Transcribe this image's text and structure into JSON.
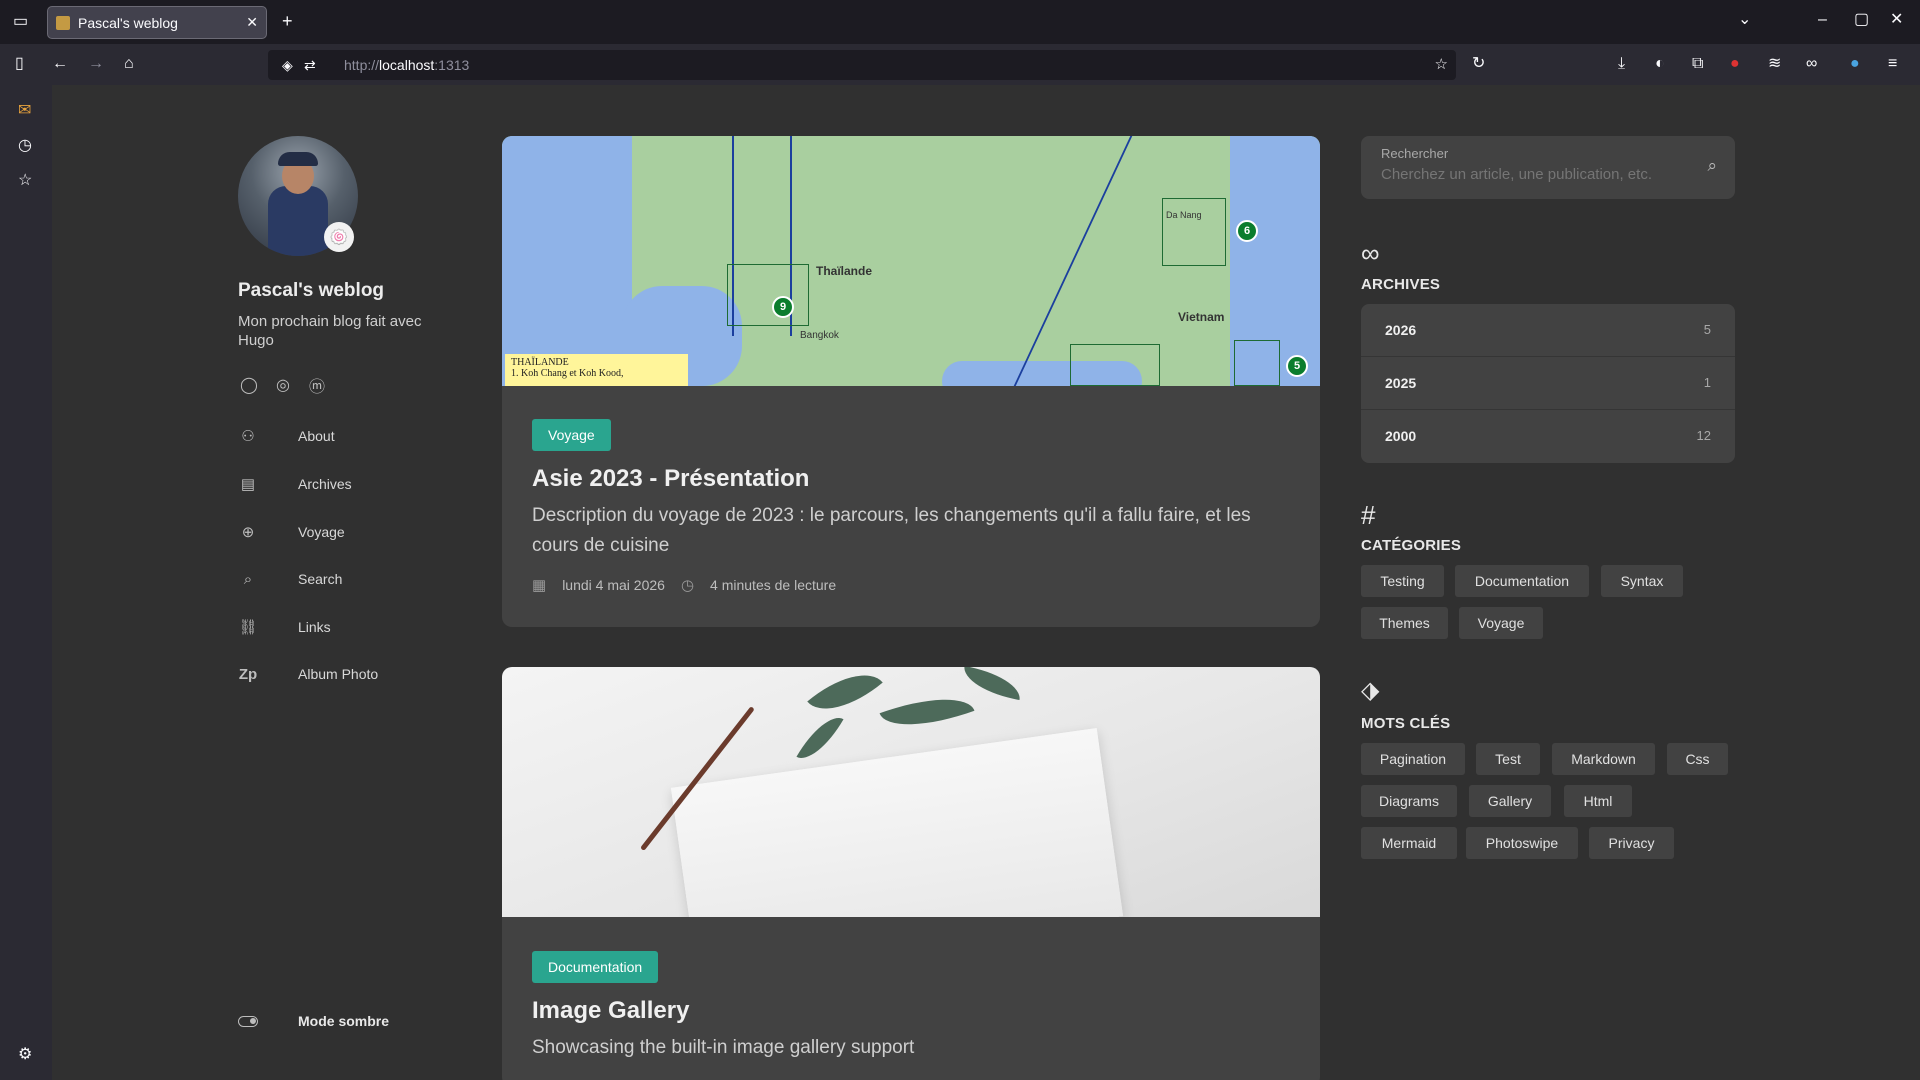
{
  "browser": {
    "tab_title": "Pascal's weblog",
    "url_prefix": "http://",
    "url_host": "localhost",
    "url_port": ":1313"
  },
  "profile": {
    "name": "Pascal's weblog",
    "description": "Mon prochain blog fait avec Hugo",
    "badge_emoji": "🍥"
  },
  "menu": {
    "items": [
      {
        "label": "About",
        "icon": "user-icon"
      },
      {
        "label": "Archives",
        "icon": "archive-icon"
      },
      {
        "label": "Voyage",
        "icon": "globe-icon"
      },
      {
        "label": "Search",
        "icon": "search-icon"
      },
      {
        "label": "Links",
        "icon": "link-icon"
      },
      {
        "label": "Album Photo",
        "icon": "zp-icon"
      }
    ],
    "dark_mode_label": "Mode sombre"
  },
  "articles": [
    {
      "category": "Voyage",
      "title": "Asie 2023 - Présentation",
      "description": "Description du voyage de 2023 : le parcours, les changements qu'il a fallu faire, et les cours de cuisine",
      "date": "lundi 4 mai 2026",
      "reading_time": "4 minutes de lecture",
      "map": {
        "labels": [
          "Thaïlande",
          "Vietnam",
          "Bangkok",
          "Da Nang"
        ],
        "pins": [
          "9",
          "6",
          "5"
        ],
        "legend_line1": "THAÏLANDE",
        "legend_line2": "1. Koh Chang et Koh Kood,"
      }
    },
    {
      "category": "Documentation",
      "title": "Image Gallery",
      "description": "Showcasing the built-in image gallery support"
    }
  ],
  "search": {
    "label": "Rechercher",
    "placeholder": "Cherchez un article, une publication, etc."
  },
  "archives": {
    "title": "ARCHIVES",
    "years": [
      {
        "year": "2026",
        "count": "5"
      },
      {
        "year": "2025",
        "count": "1"
      },
      {
        "year": "2000",
        "count": "12"
      }
    ]
  },
  "categories": {
    "title": "CATÉGORIES",
    "items": [
      "Testing",
      "Documentation",
      "Syntax",
      "Themes",
      "Voyage"
    ]
  },
  "tags": {
    "title": "MOTS CLÉS",
    "items": [
      "Pagination",
      "Test",
      "Markdown",
      "Css",
      "Diagrams",
      "Gallery",
      "Html",
      "Mermaid",
      "Photoswipe",
      "Privacy"
    ]
  },
  "colors": {
    "accent": "#2aa58f",
    "background": "#303030",
    "card": "#424242"
  }
}
